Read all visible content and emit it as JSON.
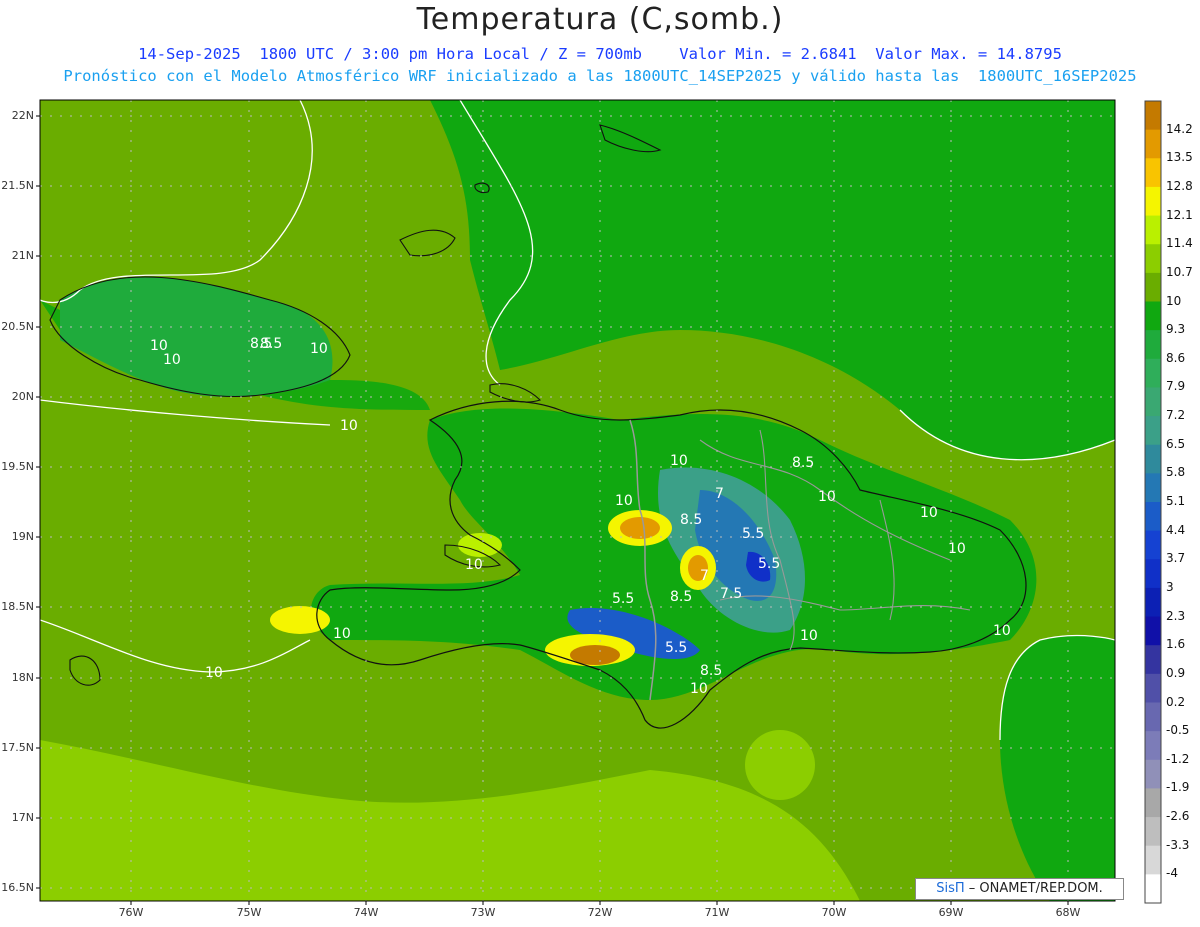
{
  "header": {
    "title": "Temperatura (C,somb.)",
    "line1": "14-Sep-2025  1800 UTC / 3:00 pm Hora Local / Z = 700mb    Valor Min. = 2.6841  Valor Max. = 14.8795",
    "line2": "Pronóstico con el Modelo Atmosférico WRF inicializado a las 1800UTC_14SEP2025 y válido hasta las  1800UTC_16SEP2025"
  },
  "axes": {
    "lat_labels": [
      "22N",
      "21.5N",
      "21N",
      "20.5N",
      "20N",
      "19.5N",
      "19N",
      "18.5N",
      "18N",
      "17.5N",
      "17N",
      "16.5N"
    ],
    "lon_labels": [
      "76W",
      "75W",
      "74W",
      "73W",
      "72W",
      "71W",
      "70W",
      "69W",
      "68W"
    ]
  },
  "colorbar": {
    "labels": [
      "14.2",
      "13.5",
      "12.8",
      "12.1",
      "11.4",
      "10.7",
      "10",
      "9.3",
      "8.6",
      "7.9",
      "7.2",
      "6.5",
      "5.8",
      "5.1",
      "4.4",
      "3.7",
      "3",
      "2.3",
      "1.6",
      "0.9",
      "0.2",
      "-0.5",
      "-1.2",
      "-1.9",
      "-2.6",
      "-3.3",
      "-4"
    ],
    "colors": [
      "#c47a00",
      "#e39a00",
      "#f9c400",
      "#f5f500",
      "#baf000",
      "#8cce00",
      "#6aad00",
      "#10a810",
      "#1fab3c",
      "#2fae5a",
      "#3aa872",
      "#3ba088",
      "#2f8a9c",
      "#2478b4",
      "#1b5cc8",
      "#1542d2",
      "#1030c8",
      "#0c20b4",
      "#1010a8",
      "#3434a0",
      "#5050a8",
      "#6868b0",
      "#7c7cb8",
      "#9090b8",
      "#a8a8a8",
      "#bebebe",
      "#d8d8d8",
      "#ffffff"
    ]
  },
  "contour_labels": [
    "10",
    "10",
    "8.5",
    "10",
    "10",
    "10",
    "8.5",
    "10",
    "10",
    "10",
    "7",
    "5.5",
    "5.5",
    "8.5",
    "10",
    "8.5",
    "7",
    "8.5",
    "5.5",
    "10",
    "10",
    "10",
    "7.5",
    "5.5",
    "8.5",
    "10",
    "10",
    "10"
  ],
  "credit": {
    "brand": "SisΠ",
    "org": " – ONAMET/REP.DOM."
  }
}
